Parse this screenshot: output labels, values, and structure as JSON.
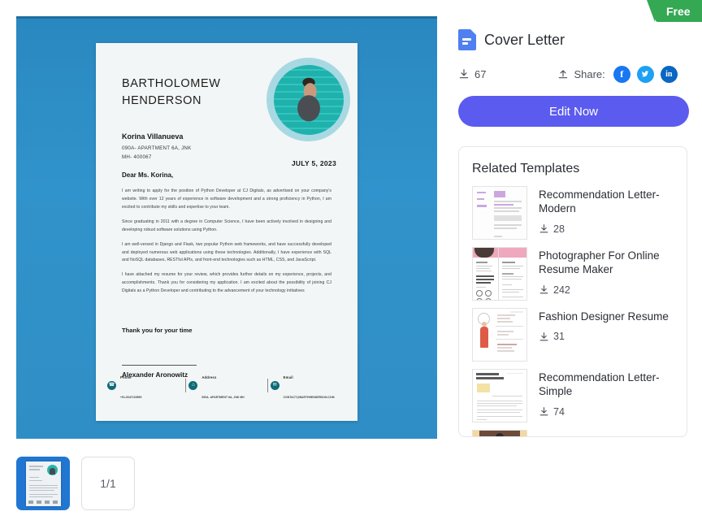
{
  "badge": {
    "label": "Free",
    "color": "#34a853"
  },
  "template": {
    "title": "Cover Letter",
    "file_icon": "document-icon",
    "download_count": "67",
    "share_label": "Share:",
    "socials": [
      {
        "name": "facebook",
        "glyph": "f",
        "color": "#1877f2"
      },
      {
        "name": "twitter",
        "glyph": "ᴠ",
        "color": "#1da1f2"
      },
      {
        "name": "linkedin",
        "glyph": "in",
        "color": "#0a66c2"
      }
    ],
    "edit_button": "Edit Now",
    "accent_color": "#5b5bef"
  },
  "related": {
    "heading": "Related Templates",
    "items": [
      {
        "name": "Recommendation Letter-Modern",
        "downloads": "28"
      },
      {
        "name": "Photographer For Online Resume Maker",
        "downloads": "242"
      },
      {
        "name": "Fashion Designer Resume",
        "downloads": "31"
      },
      {
        "name": "Recommendation Letter-Simple",
        "downloads": "74"
      }
    ]
  },
  "pages": {
    "indicator": "1/1"
  },
  "preview": {
    "canvas_color": "#2e8fc6",
    "sender_name": "BARTHOLOMEW\nHENDERSON",
    "date": "JULY 5, 2023",
    "recipient_name": "Korina Villanueva",
    "recipient_address": "090A- APARTMENT 6A, JNK\nMH- 400067",
    "salutation": "Dear Ms. Korina,",
    "paragraphs": [
      "I am writing to apply for the position of Python Developer at CJ Digitals, as advertised on your company's website. With over 12 years of experience in software development and a strong proficiency in Python, I am excited to contribute my skills and expertise to your team.",
      "Since graduating in 2011 with a degree in Computer Science, I have been actively involved in designing and developing robust software solutions using Python.",
      "I am well-versed in Django and Flask, two popular Python web frameworks, and have successfully developed and deployed numerous web applications using these technologies. Additionally, I have experience with SQL and NoSQL databases, RESTful APIs, and front-end technologies such as HTML, CSS, and JavaScript.",
      "I have attached my resume for your review, which provides further details on my experience, projects, and accomplishments. Thank you for considering my application. I am excited about the possibility of joining CJ Digitals as a Python Developer and contributing to the advancement of your technology initiatives"
    ],
    "closing": "Thank you for your time",
    "signature": "Alexander Aronowitz",
    "footer": [
      {
        "label": "Phone",
        "value": "+91-9347133599",
        "icon": "phone-icon"
      },
      {
        "label": "Address",
        "value": "090A- APARTMENT 6A, JNK MH",
        "icon": "home-icon"
      },
      {
        "label": "Email",
        "value": "CONTACT@BARTHHENDERSON.COM",
        "icon": "mail-icon"
      }
    ]
  }
}
